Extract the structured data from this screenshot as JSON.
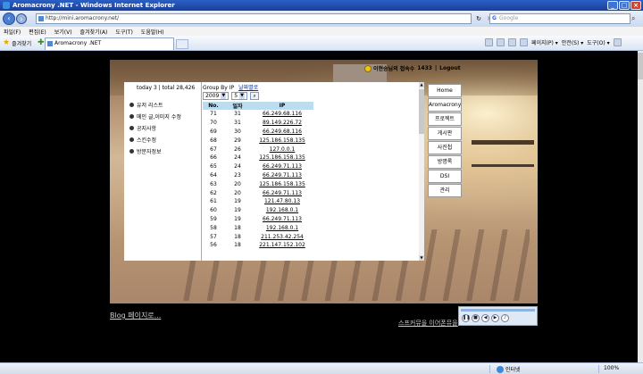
{
  "window": {
    "title": "Aromacrony .NET - Windows Internet Explorer"
  },
  "address": {
    "url": "http://mini.aromacrony.net/",
    "search_placeholder": "Google"
  },
  "menu": [
    "파일(F)",
    "편집(E)",
    "보기(V)",
    "즐겨찾기(A)",
    "도구(T)",
    "도움말(H)"
  ],
  "favorites": {
    "label": "즐겨찾기"
  },
  "tab": {
    "title": "Aromacrony .NET"
  },
  "command_bar": {
    "page": "페이지(P) ▾",
    "safety": "안전(S) ▾",
    "tools": "도구(O) ▾"
  },
  "header": {
    "greeting": "이현승님의 접속수",
    "count": "1433",
    "separator": "|",
    "logout": "Logout"
  },
  "stats": {
    "text": "today 3 | total 28,426"
  },
  "left_menu": [
    "유저 리스트",
    "메인 글,이미지 수정",
    "공지사항",
    "스킨수정",
    "방문자정보"
  ],
  "group_by": {
    "label": "Group By IP",
    "link": "날짜별로"
  },
  "filters": {
    "year": "2009",
    "month": "5"
  },
  "table": {
    "headers": [
      "No.",
      "일자",
      "IP"
    ],
    "rows": [
      [
        "71",
        "31",
        "66.249.68.116"
      ],
      [
        "70",
        "31",
        "89.149.226.72"
      ],
      [
        "69",
        "30",
        "66.249.68.116"
      ],
      [
        "68",
        "29",
        "125.186.158.135"
      ],
      [
        "67",
        "26",
        "127.0.0.1"
      ],
      [
        "66",
        "24",
        "125.186.158.135"
      ],
      [
        "65",
        "24",
        "66.249.71.113"
      ],
      [
        "64",
        "23",
        "66.249.71.113"
      ],
      [
        "63",
        "20",
        "125.186.158.135"
      ],
      [
        "62",
        "20",
        "66.249.71.113"
      ],
      [
        "61",
        "19",
        "121.47.80.13"
      ],
      [
        "60",
        "19",
        "192.168.0.1"
      ],
      [
        "59",
        "19",
        "66.249.71.113"
      ],
      [
        "58",
        "18",
        "192.168.0.1"
      ],
      [
        "57",
        "18",
        "211.253.42.254"
      ],
      [
        "56",
        "18",
        "221.147.152.102"
      ]
    ]
  },
  "right_nav": [
    "Home",
    "Aromacrony",
    "프로젝트",
    "게시판",
    "사진첩",
    "방명록",
    "DSI",
    "관리"
  ],
  "footer": {
    "blog_link": "Blog 페이지로...",
    "sf_link": "스프커뮤을 이어폰뮤을"
  },
  "statusbar": {
    "zone": "인터넷",
    "zoom": "100%"
  }
}
